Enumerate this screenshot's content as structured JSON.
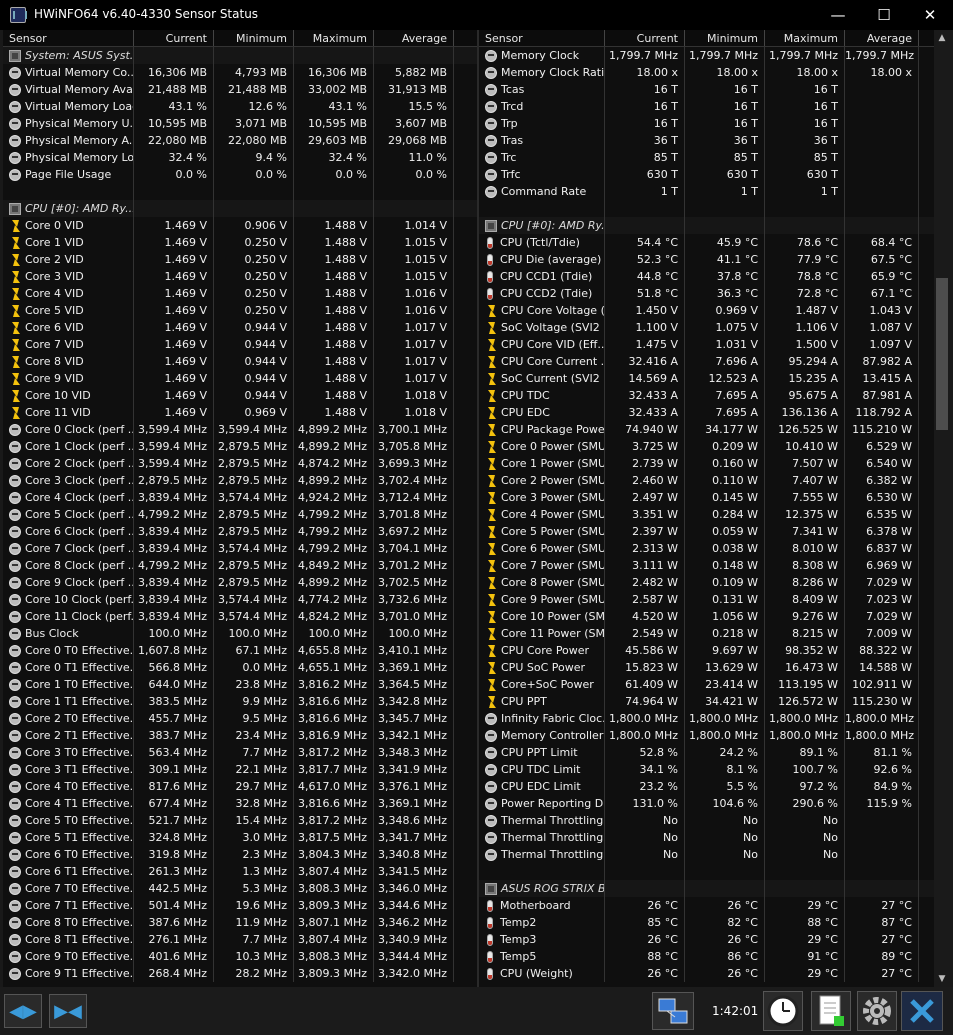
{
  "window": {
    "title": "HWiNFO64 v6.40-4330 Sensor Status",
    "minimize_glyph": "—",
    "maximize_glyph": "☐",
    "close_glyph": "✕"
  },
  "columns": {
    "sensor": "Sensor",
    "current": "Current",
    "minimum": "Minimum",
    "maximum": "Maximum",
    "average": "Average"
  },
  "left_rows": [
    {
      "t": "grp",
      "n": "System: ASUS Syst...",
      "i": "chip"
    },
    {
      "n": "Virtual Memory Co...",
      "i": "gauge",
      "v": [
        "16,306 MB",
        "4,793 MB",
        "16,306 MB",
        "5,882 MB"
      ]
    },
    {
      "n": "Virtual Memory Ava...",
      "i": "gauge",
      "v": [
        "21,488 MB",
        "21,488 MB",
        "33,002 MB",
        "31,913 MB"
      ]
    },
    {
      "n": "Virtual Memory Load",
      "i": "gauge",
      "v": [
        "43.1 %",
        "12.6 %",
        "43.1 %",
        "15.5 %"
      ]
    },
    {
      "n": "Physical Memory U...",
      "i": "gauge",
      "v": [
        "10,595 MB",
        "3,071 MB",
        "10,595 MB",
        "3,607 MB"
      ]
    },
    {
      "n": "Physical Memory A...",
      "i": "gauge",
      "v": [
        "22,080 MB",
        "22,080 MB",
        "29,603 MB",
        "29,068 MB"
      ]
    },
    {
      "n": "Physical Memory Load",
      "i": "gauge",
      "v": [
        "32.4 %",
        "9.4 %",
        "32.4 %",
        "11.0 %"
      ]
    },
    {
      "n": "Page File Usage",
      "i": "gauge",
      "v": [
        "0.0 %",
        "0.0 %",
        "0.0 %",
        "0.0 %"
      ]
    },
    {
      "t": "blank"
    },
    {
      "t": "grp",
      "n": "CPU [#0]: AMD Ry...",
      "i": "chip"
    },
    {
      "n": "Core 0 VID",
      "i": "bolt",
      "v": [
        "1.469 V",
        "0.906 V",
        "1.488 V",
        "1.014 V"
      ]
    },
    {
      "n": "Core 1 VID",
      "i": "bolt",
      "v": [
        "1.469 V",
        "0.250 V",
        "1.488 V",
        "1.015 V"
      ]
    },
    {
      "n": "Core 2 VID",
      "i": "bolt",
      "v": [
        "1.469 V",
        "0.250 V",
        "1.488 V",
        "1.015 V"
      ]
    },
    {
      "n": "Core 3 VID",
      "i": "bolt",
      "v": [
        "1.469 V",
        "0.250 V",
        "1.488 V",
        "1.015 V"
      ]
    },
    {
      "n": "Core 4 VID",
      "i": "bolt",
      "v": [
        "1.469 V",
        "0.250 V",
        "1.488 V",
        "1.016 V"
      ]
    },
    {
      "n": "Core 5 VID",
      "i": "bolt",
      "v": [
        "1.469 V",
        "0.250 V",
        "1.488 V",
        "1.016 V"
      ]
    },
    {
      "n": "Core 6 VID",
      "i": "bolt",
      "v": [
        "1.469 V",
        "0.944 V",
        "1.488 V",
        "1.017 V"
      ]
    },
    {
      "n": "Core 7 VID",
      "i": "bolt",
      "v": [
        "1.469 V",
        "0.944 V",
        "1.488 V",
        "1.017 V"
      ]
    },
    {
      "n": "Core 8 VID",
      "i": "bolt",
      "v": [
        "1.469 V",
        "0.944 V",
        "1.488 V",
        "1.017 V"
      ]
    },
    {
      "n": "Core 9 VID",
      "i": "bolt",
      "v": [
        "1.469 V",
        "0.944 V",
        "1.488 V",
        "1.017 V"
      ]
    },
    {
      "n": "Core 10 VID",
      "i": "bolt",
      "v": [
        "1.469 V",
        "0.944 V",
        "1.488 V",
        "1.018 V"
      ]
    },
    {
      "n": "Core 11 VID",
      "i": "bolt",
      "v": [
        "1.469 V",
        "0.969 V",
        "1.488 V",
        "1.018 V"
      ]
    },
    {
      "n": "Core 0 Clock (perf ...",
      "i": "gauge",
      "v": [
        "3,599.4 MHz",
        "3,599.4 MHz",
        "4,899.2 MHz",
        "3,700.1 MHz"
      ]
    },
    {
      "n": "Core 1 Clock (perf ...",
      "i": "gauge",
      "v": [
        "3,599.4 MHz",
        "2,879.5 MHz",
        "4,899.2 MHz",
        "3,705.8 MHz"
      ]
    },
    {
      "n": "Core 2 Clock (perf ...",
      "i": "gauge",
      "v": [
        "3,599.4 MHz",
        "2,879.5 MHz",
        "4,874.2 MHz",
        "3,699.3 MHz"
      ]
    },
    {
      "n": "Core 3 Clock (perf ...",
      "i": "gauge",
      "v": [
        "2,879.5 MHz",
        "2,879.5 MHz",
        "4,899.2 MHz",
        "3,702.4 MHz"
      ]
    },
    {
      "n": "Core 4 Clock (perf ...",
      "i": "gauge",
      "v": [
        "3,839.4 MHz",
        "3,574.4 MHz",
        "4,924.2 MHz",
        "3,712.4 MHz"
      ]
    },
    {
      "n": "Core 5 Clock (perf ...",
      "i": "gauge",
      "v": [
        "4,799.2 MHz",
        "2,879.5 MHz",
        "4,799.2 MHz",
        "3,701.8 MHz"
      ]
    },
    {
      "n": "Core 6 Clock (perf ...",
      "i": "gauge",
      "v": [
        "3,839.4 MHz",
        "2,879.5 MHz",
        "4,799.2 MHz",
        "3,697.2 MHz"
      ]
    },
    {
      "n": "Core 7 Clock (perf ...",
      "i": "gauge",
      "v": [
        "3,839.4 MHz",
        "3,574.4 MHz",
        "4,799.2 MHz",
        "3,704.1 MHz"
      ]
    },
    {
      "n": "Core 8 Clock (perf ...",
      "i": "gauge",
      "v": [
        "4,799.2 MHz",
        "2,879.5 MHz",
        "4,849.2 MHz",
        "3,701.2 MHz"
      ]
    },
    {
      "n": "Core 9 Clock (perf ...",
      "i": "gauge",
      "v": [
        "3,839.4 MHz",
        "2,879.5 MHz",
        "4,899.2 MHz",
        "3,702.5 MHz"
      ]
    },
    {
      "n": "Core 10 Clock (perf...",
      "i": "gauge",
      "v": [
        "3,839.4 MHz",
        "3,574.4 MHz",
        "4,774.2 MHz",
        "3,732.6 MHz"
      ]
    },
    {
      "n": "Core 11 Clock (perf...",
      "i": "gauge",
      "v": [
        "3,839.4 MHz",
        "3,574.4 MHz",
        "4,824.2 MHz",
        "3,701.0 MHz"
      ]
    },
    {
      "n": "Bus Clock",
      "i": "gauge",
      "v": [
        "100.0 MHz",
        "100.0 MHz",
        "100.0 MHz",
        "100.0 MHz"
      ]
    },
    {
      "n": "Core 0 T0 Effective...",
      "i": "gauge",
      "v": [
        "1,607.8 MHz",
        "67.1 MHz",
        "4,655.8 MHz",
        "3,410.1 MHz"
      ]
    },
    {
      "n": "Core 0 T1 Effective...",
      "i": "gauge",
      "v": [
        "566.8 MHz",
        "0.0 MHz",
        "4,655.1 MHz",
        "3,369.1 MHz"
      ]
    },
    {
      "n": "Core 1 T0 Effective...",
      "i": "gauge",
      "v": [
        "644.0 MHz",
        "23.8 MHz",
        "3,816.2 MHz",
        "3,364.5 MHz"
      ]
    },
    {
      "n": "Core 1 T1 Effective...",
      "i": "gauge",
      "v": [
        "383.5 MHz",
        "9.9 MHz",
        "3,816.6 MHz",
        "3,342.8 MHz"
      ]
    },
    {
      "n": "Core 2 T0 Effective...",
      "i": "gauge",
      "v": [
        "455.7 MHz",
        "9.5 MHz",
        "3,816.6 MHz",
        "3,345.7 MHz"
      ]
    },
    {
      "n": "Core 2 T1 Effective...",
      "i": "gauge",
      "v": [
        "383.7 MHz",
        "23.4 MHz",
        "3,816.9 MHz",
        "3,342.1 MHz"
      ]
    },
    {
      "n": "Core 3 T0 Effective...",
      "i": "gauge",
      "v": [
        "563.4 MHz",
        "7.7 MHz",
        "3,817.2 MHz",
        "3,348.3 MHz"
      ]
    },
    {
      "n": "Core 3 T1 Effective...",
      "i": "gauge",
      "v": [
        "309.1 MHz",
        "22.1 MHz",
        "3,817.7 MHz",
        "3,341.9 MHz"
      ]
    },
    {
      "n": "Core 4 T0 Effective...",
      "i": "gauge",
      "v": [
        "817.6 MHz",
        "29.7 MHz",
        "4,617.0 MHz",
        "3,376.1 MHz"
      ]
    },
    {
      "n": "Core 4 T1 Effective...",
      "i": "gauge",
      "v": [
        "677.4 MHz",
        "32.8 MHz",
        "3,816.6 MHz",
        "3,369.1 MHz"
      ]
    },
    {
      "n": "Core 5 T0 Effective...",
      "i": "gauge",
      "v": [
        "521.7 MHz",
        "15.4 MHz",
        "3,817.2 MHz",
        "3,348.6 MHz"
      ]
    },
    {
      "n": "Core 5 T1 Effective...",
      "i": "gauge",
      "v": [
        "324.8 MHz",
        "3.0 MHz",
        "3,817.5 MHz",
        "3,341.7 MHz"
      ]
    },
    {
      "n": "Core 6 T0 Effective...",
      "i": "gauge",
      "v": [
        "319.8 MHz",
        "2.3 MHz",
        "3,804.3 MHz",
        "3,340.8 MHz"
      ]
    },
    {
      "n": "Core 6 T1 Effective...",
      "i": "gauge",
      "v": [
        "261.3 MHz",
        "1.3 MHz",
        "3,807.4 MHz",
        "3,341.5 MHz"
      ]
    },
    {
      "n": "Core 7 T0 Effective...",
      "i": "gauge",
      "v": [
        "442.5 MHz",
        "5.3 MHz",
        "3,808.3 MHz",
        "3,346.0 MHz"
      ]
    },
    {
      "n": "Core 7 T1 Effective...",
      "i": "gauge",
      "v": [
        "501.4 MHz",
        "19.6 MHz",
        "3,809.3 MHz",
        "3,344.6 MHz"
      ]
    },
    {
      "n": "Core 8 T0 Effective...",
      "i": "gauge",
      "v": [
        "387.6 MHz",
        "11.9 MHz",
        "3,807.1 MHz",
        "3,346.2 MHz"
      ]
    },
    {
      "n": "Core 8 T1 Effective...",
      "i": "gauge",
      "v": [
        "276.1 MHz",
        "7.7 MHz",
        "3,807.4 MHz",
        "3,340.9 MHz"
      ]
    },
    {
      "n": "Core 9 T0 Effective...",
      "i": "gauge",
      "v": [
        "401.6 MHz",
        "10.3 MHz",
        "3,808.3 MHz",
        "3,344.4 MHz"
      ]
    },
    {
      "n": "Core 9 T1 Effective...",
      "i": "gauge",
      "v": [
        "268.4 MHz",
        "28.2 MHz",
        "3,809.3 MHz",
        "3,342.0 MHz"
      ]
    }
  ],
  "right_rows": [
    {
      "n": "Memory Clock",
      "i": "gauge",
      "v": [
        "1,799.7 MHz",
        "1,799.7 MHz",
        "1,799.7 MHz",
        "1,799.7 MHz"
      ]
    },
    {
      "n": "Memory Clock Ratio",
      "i": "gauge",
      "v": [
        "18.00 x",
        "18.00 x",
        "18.00 x",
        "18.00 x"
      ]
    },
    {
      "n": "Tcas",
      "i": "gauge",
      "v": [
        "16 T",
        "16 T",
        "16 T",
        ""
      ]
    },
    {
      "n": "Trcd",
      "i": "gauge",
      "v": [
        "16 T",
        "16 T",
        "16 T",
        ""
      ]
    },
    {
      "n": "Trp",
      "i": "gauge",
      "v": [
        "16 T",
        "16 T",
        "16 T",
        ""
      ]
    },
    {
      "n": "Tras",
      "i": "gauge",
      "v": [
        "36 T",
        "36 T",
        "36 T",
        ""
      ]
    },
    {
      "n": "Trc",
      "i": "gauge",
      "v": [
        "85 T",
        "85 T",
        "85 T",
        ""
      ]
    },
    {
      "n": "Trfc",
      "i": "gauge",
      "v": [
        "630 T",
        "630 T",
        "630 T",
        ""
      ]
    },
    {
      "n": "Command Rate",
      "i": "gauge",
      "v": [
        "1 T",
        "1 T",
        "1 T",
        ""
      ]
    },
    {
      "t": "blank"
    },
    {
      "t": "grp",
      "n": "CPU [#0]: AMD Ry...",
      "i": "chip"
    },
    {
      "n": "CPU (Tctl/Tdie)",
      "i": "therm",
      "v": [
        "54.4 °C",
        "45.9 °C",
        "78.6 °C",
        "68.4 °C"
      ]
    },
    {
      "n": "CPU Die (average)",
      "i": "therm",
      "v": [
        "52.3 °C",
        "41.1 °C",
        "77.9 °C",
        "67.5 °C"
      ]
    },
    {
      "n": "CPU CCD1 (Tdie)",
      "i": "therm",
      "v": [
        "44.8 °C",
        "37.8 °C",
        "78.8 °C",
        "65.9 °C"
      ]
    },
    {
      "n": "CPU CCD2 (Tdie)",
      "i": "therm",
      "v": [
        "51.8 °C",
        "36.3 °C",
        "72.8 °C",
        "67.1 °C"
      ]
    },
    {
      "n": "CPU Core Voltage (...",
      "i": "bolt",
      "v": [
        "1.450 V",
        "0.969 V",
        "1.487 V",
        "1.043 V"
      ]
    },
    {
      "n": "SoC Voltage (SVI2 ...",
      "i": "bolt",
      "v": [
        "1.100 V",
        "1.075 V",
        "1.106 V",
        "1.087 V"
      ]
    },
    {
      "n": "CPU Core VID (Eff...",
      "i": "bolt",
      "v": [
        "1.475 V",
        "1.031 V",
        "1.500 V",
        "1.097 V"
      ]
    },
    {
      "n": "CPU Core Current ...",
      "i": "bolt",
      "v": [
        "32.416 A",
        "7.696 A",
        "95.294 A",
        "87.982 A"
      ]
    },
    {
      "n": "SoC Current (SVI2 ...",
      "i": "bolt",
      "v": [
        "14.569 A",
        "12.523 A",
        "15.235 A",
        "13.415 A"
      ]
    },
    {
      "n": "CPU TDC",
      "i": "bolt",
      "v": [
        "32.433 A",
        "7.695 A",
        "95.675 A",
        "87.981 A"
      ]
    },
    {
      "n": "CPU EDC",
      "i": "bolt",
      "v": [
        "32.433 A",
        "7.695 A",
        "136.136 A",
        "118.792 A"
      ]
    },
    {
      "n": "CPU Package Powe...",
      "i": "bolt",
      "v": [
        "74.940 W",
        "34.177 W",
        "126.525 W",
        "115.210 W"
      ]
    },
    {
      "n": "Core 0 Power (SMU)",
      "i": "bolt",
      "v": [
        "3.725 W",
        "0.209 W",
        "10.410 W",
        "6.529 W"
      ]
    },
    {
      "n": "Core 1 Power (SMU)",
      "i": "bolt",
      "v": [
        "2.739 W",
        "0.160 W",
        "7.507 W",
        "6.540 W"
      ]
    },
    {
      "n": "Core 2 Power (SMU)",
      "i": "bolt",
      "v": [
        "2.460 W",
        "0.110 W",
        "7.407 W",
        "6.382 W"
      ]
    },
    {
      "n": "Core 3 Power (SMU)",
      "i": "bolt",
      "v": [
        "2.497 W",
        "0.145 W",
        "7.555 W",
        "6.530 W"
      ]
    },
    {
      "n": "Core 4 Power (SMU)",
      "i": "bolt",
      "v": [
        "3.351 W",
        "0.284 W",
        "12.375 W",
        "6.535 W"
      ]
    },
    {
      "n": "Core 5 Power (SMU)",
      "i": "bolt",
      "v": [
        "2.397 W",
        "0.059 W",
        "7.341 W",
        "6.378 W"
      ]
    },
    {
      "n": "Core 6 Power (SMU)",
      "i": "bolt",
      "v": [
        "2.313 W",
        "0.038 W",
        "8.010 W",
        "6.837 W"
      ]
    },
    {
      "n": "Core 7 Power (SMU)",
      "i": "bolt",
      "v": [
        "3.111 W",
        "0.148 W",
        "8.308 W",
        "6.969 W"
      ]
    },
    {
      "n": "Core 8 Power (SMU)",
      "i": "bolt",
      "v": [
        "2.482 W",
        "0.109 W",
        "8.286 W",
        "7.029 W"
      ]
    },
    {
      "n": "Core 9 Power (SMU)",
      "i": "bolt",
      "v": [
        "2.587 W",
        "0.131 W",
        "8.409 W",
        "7.023 W"
      ]
    },
    {
      "n": "Core 10 Power (SMU)",
      "i": "bolt",
      "v": [
        "4.520 W",
        "1.056 W",
        "9.276 W",
        "7.029 W"
      ]
    },
    {
      "n": "Core 11 Power (SMU)",
      "i": "bolt",
      "v": [
        "2.549 W",
        "0.218 W",
        "8.215 W",
        "7.009 W"
      ]
    },
    {
      "n": "CPU Core Power",
      "i": "bolt",
      "v": [
        "45.586 W",
        "9.697 W",
        "98.352 W",
        "88.322 W"
      ]
    },
    {
      "n": "CPU SoC Power",
      "i": "bolt",
      "v": [
        "15.823 W",
        "13.629 W",
        "16.473 W",
        "14.588 W"
      ]
    },
    {
      "n": "Core+SoC Power",
      "i": "bolt",
      "v": [
        "61.409 W",
        "23.414 W",
        "113.195 W",
        "102.911 W"
      ]
    },
    {
      "n": "CPU PPT",
      "i": "bolt",
      "v": [
        "74.964 W",
        "34.421 W",
        "126.572 W",
        "115.230 W"
      ]
    },
    {
      "n": "Infinity Fabric Cloc...",
      "i": "gauge",
      "v": [
        "1,800.0 MHz",
        "1,800.0 MHz",
        "1,800.0 MHz",
        "1,800.0 MHz"
      ]
    },
    {
      "n": "Memory Controller ...",
      "i": "gauge",
      "v": [
        "1,800.0 MHz",
        "1,800.0 MHz",
        "1,800.0 MHz",
        "1,800.0 MHz"
      ]
    },
    {
      "n": "CPU PPT Limit",
      "i": "gauge",
      "v": [
        "52.8 %",
        "24.2 %",
        "89.1 %",
        "81.1 %"
      ]
    },
    {
      "n": "CPU TDC Limit",
      "i": "gauge",
      "v": [
        "34.1 %",
        "8.1 %",
        "100.7 %",
        "92.6 %"
      ]
    },
    {
      "n": "CPU EDC Limit",
      "i": "gauge",
      "v": [
        "23.2 %",
        "5.5 %",
        "97.2 %",
        "84.9 %"
      ]
    },
    {
      "n": "Power Reporting D...",
      "i": "gauge",
      "v": [
        "131.0 %",
        "104.6 %",
        "290.6 %",
        "115.9 %"
      ]
    },
    {
      "n": "Thermal Throttling ...",
      "i": "gauge",
      "v": [
        "No",
        "No",
        "No",
        ""
      ]
    },
    {
      "n": "Thermal Throttling ...",
      "i": "gauge",
      "v": [
        "No",
        "No",
        "No",
        ""
      ]
    },
    {
      "n": "Thermal Throttling ...",
      "i": "gauge",
      "v": [
        "No",
        "No",
        "No",
        ""
      ]
    },
    {
      "t": "blank"
    },
    {
      "t": "grp",
      "n": "ASUS ROG STRIX B...",
      "i": "chip"
    },
    {
      "n": "Motherboard",
      "i": "therm",
      "v": [
        "26 °C",
        "26 °C",
        "29 °C",
        "27 °C"
      ]
    },
    {
      "n": "Temp2",
      "i": "therm",
      "v": [
        "85 °C",
        "82 °C",
        "88 °C",
        "87 °C"
      ]
    },
    {
      "n": "Temp3",
      "i": "therm",
      "v": [
        "26 °C",
        "26 °C",
        "29 °C",
        "27 °C"
      ]
    },
    {
      "n": "Temp5",
      "i": "therm",
      "v": [
        "88 °C",
        "86 °C",
        "91 °C",
        "89 °C"
      ]
    },
    {
      "n": "CPU (Weight)",
      "i": "therm",
      "v": [
        "26 °C",
        "26 °C",
        "29 °C",
        "27 °C"
      ]
    }
  ],
  "toolbar": {
    "timer": "1:42:01",
    "prev_glyph": "◀▶",
    "next_glyph": "▶◀"
  },
  "colors": {
    "accent": "#3a9ad9",
    "bolt": "#f4c20d",
    "background": "#0f0f0f"
  },
  "icons": {
    "gauge": "gauge-icon",
    "bolt": "voltage-bolt-icon",
    "therm": "thermometer-icon",
    "chip": "chip-icon"
  }
}
